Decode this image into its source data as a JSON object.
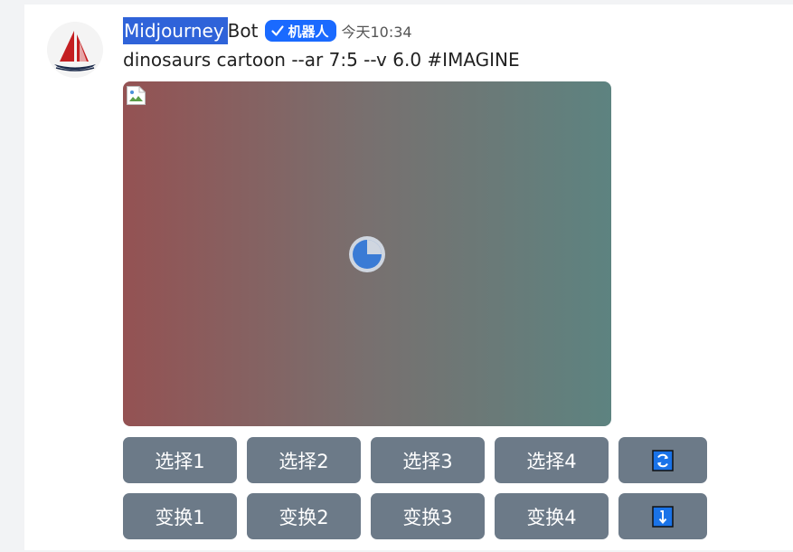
{
  "message": {
    "author_highlight": "Midjourney",
    "author_rest": "Bot",
    "badge_label": "机器人",
    "badge_icon": "checkmark-icon",
    "timestamp": "今天10:34",
    "text": "dinosaurs cartoon --ar 7:5 --v 6.0 #IMAGINE"
  },
  "image": {
    "state": "loading",
    "gradient_colors": [
      "#945253",
      "#78706f",
      "#5d8380"
    ],
    "spinner_color": "#3a7bd5",
    "progress": 0.25
  },
  "buttons": {
    "select": [
      "选择1",
      "选择2",
      "选择3",
      "选择4"
    ],
    "reroll_icon": "refresh-icon",
    "variation": [
      "变换1",
      "变换2",
      "变换3",
      "变换4"
    ],
    "down_icon": "arrow-down-icon"
  },
  "colors": {
    "button_bg": "#6c7a88",
    "badge_bg": "#1a6aff",
    "name_highlight": "#2f63d9"
  }
}
